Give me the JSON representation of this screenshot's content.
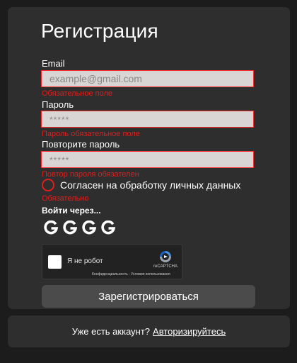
{
  "form": {
    "title": "Регистрация",
    "email": {
      "label": "Email",
      "placeholder": "example@gmail.com",
      "value": "",
      "error": "Обязательное поле"
    },
    "password": {
      "label": "Пароль",
      "placeholder": "*****",
      "value": "",
      "error": "Пароль обязательное поле"
    },
    "password_repeat": {
      "label": "Повторите пароль",
      "placeholder": "*****",
      "value": "",
      "error": "Повтор пароля обязателен"
    },
    "consent": {
      "label": "Согласен на обработку личных данных",
      "checked": false,
      "error": "Обязательно"
    },
    "social": {
      "label": "Войти через...",
      "icons": [
        "google-icon",
        "google-icon",
        "google-icon",
        "google-icon"
      ]
    },
    "captcha": {
      "label": "Я не робот",
      "brand": "reCAPTCHA",
      "links": "Конфиденциальность - Условия использования",
      "checked": false
    },
    "submit_label": "Зарегистрироваться"
  },
  "footer": {
    "text": "Уже есть аккаунт?",
    "link": "Авторизируйтесь"
  },
  "colors": {
    "background": "#1c1c1c",
    "card": "#2e2e2e",
    "field": "#d9d5d5",
    "error": "#e01e1e",
    "button": "#4b4b4b"
  }
}
